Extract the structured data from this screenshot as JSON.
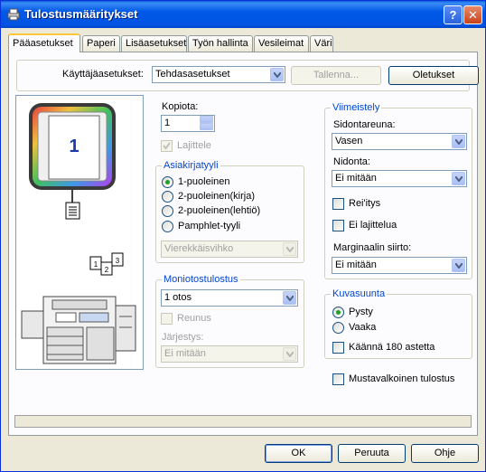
{
  "window": {
    "title": "Tulostusmääritykset",
    "help_btn": "?",
    "close_btn": "✕"
  },
  "tabs": [
    {
      "label": "Pääasetukset"
    },
    {
      "label": "Paperi"
    },
    {
      "label": "Lisäasetukset"
    },
    {
      "label": "Työn hallinta"
    },
    {
      "label": "Vesileimat"
    },
    {
      "label": "Väri"
    }
  ],
  "user_settings": {
    "label": "Käyttäjäasetukset:",
    "value": "Tehdasasetukset",
    "save_btn": "Tallenna...",
    "defaults_btn": "Oletukset"
  },
  "preview": {
    "page_number": "1"
  },
  "copies": {
    "label": "Kopiota:",
    "value": "1",
    "collate_label": "Lajittele"
  },
  "document_style": {
    "title": "Asiakirjatyyli",
    "options": [
      {
        "label": "1-puoleinen"
      },
      {
        "label": "2-puoleinen(kirja)"
      },
      {
        "label": "2-puoleinen(lehtiö)"
      },
      {
        "label": "Pamphlet-tyyli"
      }
    ],
    "selected_index": 0,
    "pamphlet_combo": "Vierekkäisvihko"
  },
  "multi_output": {
    "title": "Moniotostulostus",
    "value": "1 otos",
    "border_label": "Reunus",
    "order_label": "Järjestys:",
    "order_value": "Ei mitään"
  },
  "finishing": {
    "title": "Viimeistely",
    "binding_edge_label": "Sidontareuna:",
    "binding_edge_value": "Vasen",
    "binding_label": "Nidonta:",
    "binding_value": "Ei mitään",
    "punch_label": "Rei'itys",
    "no_collate_label": "Ei lajittelua",
    "margin_shift_label": "Marginaalin siirto:",
    "margin_shift_value": "Ei mitään"
  },
  "orientation": {
    "title": "Kuvasuunta",
    "portrait": "Pysty",
    "landscape": "Vaaka",
    "rotate_label": "Käännä 180 astetta"
  },
  "bw_print_label": "Mustavalkoinen tulostus",
  "buttons": {
    "ok": "OK",
    "cancel": "Peruuta",
    "help": "Ohje"
  },
  "colors": {
    "title_blue": "#0054e3",
    "group_label": "#0046d5",
    "radio_dot": "#21a121",
    "tab_highlight": "#ffc83c"
  }
}
